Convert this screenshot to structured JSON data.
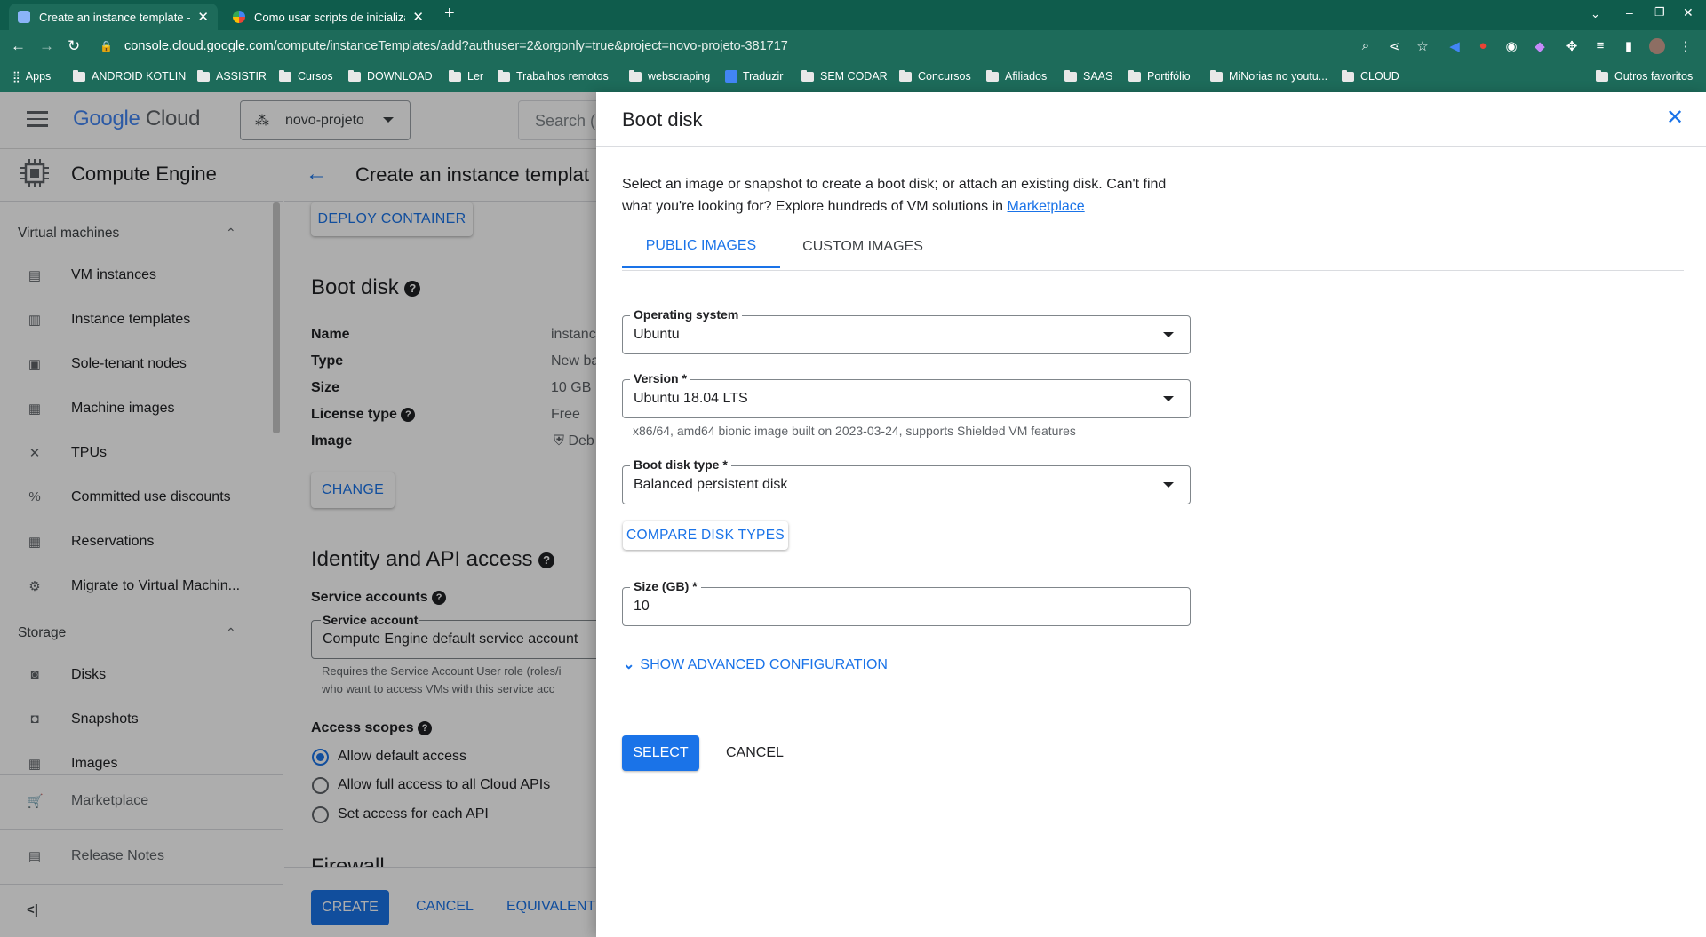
{
  "browser": {
    "tabs": [
      {
        "title": "Create an instance template – (",
        "close": "✕"
      },
      {
        "title": "Como usar scripts de inicializaç",
        "close": "✕"
      }
    ],
    "new_tab": "+",
    "url_host": "console.cloud.google.com",
    "url_path": "/compute/instanceTemplates/add?authuser=2&orgonly=true&project=novo-projeto-381717",
    "bookmarks": [
      "Apps",
      "ANDROID KOTLIN",
      "ASSISTIR",
      "Cursos",
      "DOWNLOAD",
      "Ler",
      "Trabalhos remotos",
      "webscraping",
      "Traduzir",
      "SEM CODAR",
      "Concursos",
      "Afiliados",
      "SAAS",
      "Portifólio",
      "MiNorias no youtu...",
      "CLOUD"
    ],
    "other_bookmarks": "Outros favoritos"
  },
  "console": {
    "logo_google": "Google",
    "logo_cloud": "Cloud",
    "project": "novo-projeto",
    "search_placeholder": "Search ("
  },
  "sidebar": {
    "title": "Compute Engine",
    "section_vm": "Virtual machines",
    "vm_items": [
      "VM instances",
      "Instance templates",
      "Sole-tenant nodes",
      "Machine images",
      "TPUs",
      "Committed use discounts",
      "Reservations",
      "Migrate to Virtual Machin..."
    ],
    "section_storage": "Storage",
    "storage_items": [
      "Disks",
      "Snapshots",
      "Images"
    ],
    "marketplace": "Marketplace",
    "release_notes": "Release Notes",
    "collapse": "<|"
  },
  "main": {
    "page_title": "Create an instance templat",
    "deploy_container": "DEPLOY CONTAINER",
    "boot_disk_heading": "Boot disk",
    "boot_rows": [
      {
        "label": "Name",
        "value": "instanc"
      },
      {
        "label": "Type",
        "value": "New ba"
      },
      {
        "label": "Size",
        "value": "10 GB"
      },
      {
        "label": "License type",
        "value": "Free"
      },
      {
        "label": "Image",
        "value": "Deb"
      }
    ],
    "change": "CHANGE",
    "identity_heading": "Identity and API access",
    "service_accounts": "Service accounts",
    "service_account_label": "Service account",
    "service_account_value": "Compute Engine default service account",
    "sa_hint_1": "Requires the Service Account User role (roles/i",
    "sa_hint_2": "who want to access VMs with this service acc",
    "access_scopes": "Access scopes",
    "scopes": [
      "Allow default access",
      "Allow full access to all Cloud APIs",
      "Set access for each API"
    ],
    "firewall_partial": "Firewall",
    "create": "CREATE",
    "cancel": "CANCEL",
    "equivalent": "EQUIVALENT"
  },
  "panel": {
    "title": "Boot disk",
    "desc_1": "Select an image or snapshot to create a boot disk; or attach an existing disk. Can't find",
    "desc_2": "what you're looking for? Explore hundreds of VM solutions in ",
    "marketplace_link": "Marketplace",
    "tabs": [
      "PUBLIC IMAGES",
      "CUSTOM IMAGES"
    ],
    "os_label": "Operating system",
    "os_value": "Ubuntu",
    "version_label": "Version *",
    "version_value": "Ubuntu 18.04 LTS",
    "version_hint": "x86/64, amd64 bionic image built on 2023-03-24, supports Shielded VM features",
    "disk_type_label": "Boot disk type *",
    "disk_type_value": "Balanced persistent disk",
    "compare": "COMPARE DISK TYPES",
    "size_label": "Size (GB) *",
    "size_value": "10",
    "advanced": "SHOW ADVANCED CONFIGURATION",
    "select": "SELECT",
    "cancel": "CANCEL"
  },
  "colors": {
    "accent": "#1a73e8",
    "chrome": "#1d6b5a",
    "tabbar": "#0f5c4c"
  }
}
